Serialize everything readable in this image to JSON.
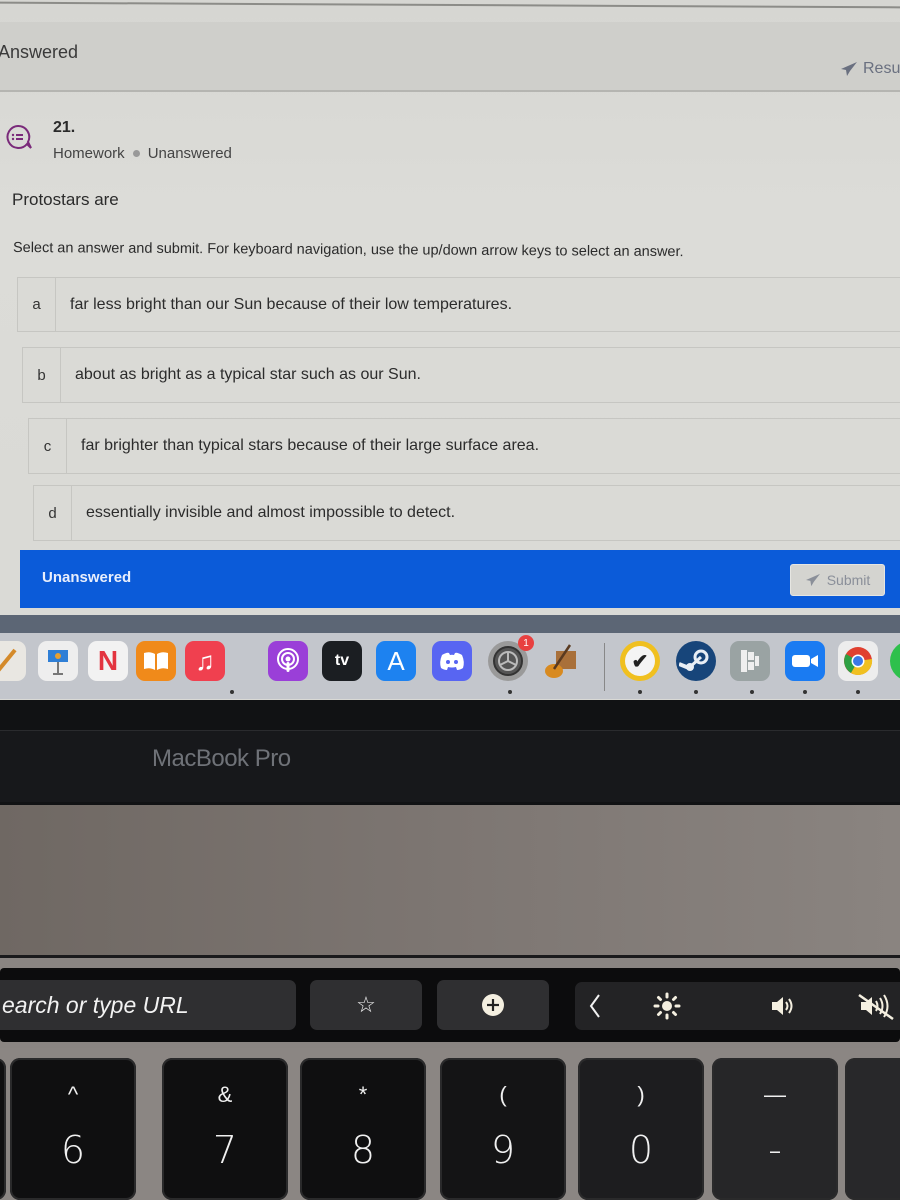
{
  "screen": {
    "answered_header": "Answered",
    "results_button": {
      "label": "Resu",
      "icon": "paper-plane-icon"
    },
    "question": {
      "number": "21.",
      "type": "Homework",
      "status": "Unanswered",
      "icon": "multiple-choice-chat-icon",
      "prompt": "Protostars are",
      "instructions": "Select an answer and submit. For keyboard navigation, use the up/down arrow keys to select an answer.",
      "choices": [
        {
          "letter": "a",
          "text": "far less bright than our Sun because of their low temperatures."
        },
        {
          "letter": "b",
          "text": "about as bright as a typical star such as our Sun."
        },
        {
          "letter": "c",
          "text": "far brighter than typical stars because of their large surface area."
        },
        {
          "letter": "d",
          "text": "essentially invisible and almost impossible to detect."
        }
      ]
    },
    "status_bar": {
      "status": "Unanswered",
      "submit_label": "Submit",
      "color": "#0b5bd9"
    },
    "dock": {
      "apps": [
        {
          "name": "pencil",
          "label": ""
        },
        {
          "name": "keynote",
          "label": ""
        },
        {
          "name": "news",
          "label": "N"
        },
        {
          "name": "books",
          "label": ""
        },
        {
          "name": "music",
          "label": "♫"
        },
        {
          "name": "podcasts",
          "label": ""
        },
        {
          "name": "apple-tv",
          "label": "tv"
        },
        {
          "name": "app-store",
          "label": "A"
        },
        {
          "name": "discord",
          "label": ""
        },
        {
          "name": "system-preferences",
          "label": "",
          "badge": "1"
        },
        {
          "name": "garageband",
          "label": ""
        },
        {
          "name": "norton",
          "label": "✔"
        },
        {
          "name": "steam",
          "label": ""
        },
        {
          "name": "dashlane",
          "label": ""
        },
        {
          "name": "zoom",
          "label": ""
        },
        {
          "name": "chrome",
          "label": ""
        }
      ]
    }
  },
  "laptop": {
    "brand": "MacBook Pro"
  },
  "touchbar": {
    "url_placeholder": "earch or type URL",
    "star": "☆",
    "controls": [
      "collapse",
      "brightness",
      "volume",
      "mute"
    ]
  },
  "keys": [
    {
      "shift": "^",
      "main": "6"
    },
    {
      "shift": "&",
      "main": "7"
    },
    {
      "shift": "*",
      "main": "8"
    },
    {
      "shift": "(",
      "main": "9"
    },
    {
      "shift": ")",
      "main": "0"
    },
    {
      "shift": "—",
      "main": "-"
    }
  ]
}
